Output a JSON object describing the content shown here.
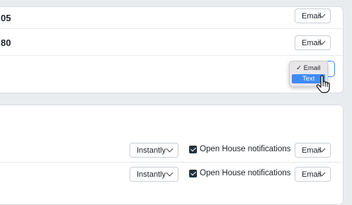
{
  "top_card": {
    "rows": [
      {
        "label": "05",
        "delivery": "Email"
      },
      {
        "label": "80",
        "delivery": "Email"
      }
    ],
    "dropdown": {
      "options": [
        {
          "label": "Email",
          "checked": true,
          "check_mark": "✓"
        },
        {
          "label": "Text",
          "checked": false,
          "highlighted": true
        }
      ]
    }
  },
  "bottom_card": {
    "rows": [
      {
        "frequency": "Instantly",
        "notification_label": "Open House notifications",
        "checked": true,
        "delivery": "Email"
      },
      {
        "frequency": "Instantly",
        "notification_label": "Open House notifications",
        "checked": true,
        "delivery": "Email"
      }
    ]
  },
  "icons": {
    "select_chevron": "chevron-down-icon",
    "checkbox": "checkbox-checked-icon",
    "cursor": "hand-pointer-cursor-icon"
  },
  "colors": {
    "accent_blue": "#3f8bf6",
    "checkbox_fill": "#25313d",
    "focus_border": "#3b8be8"
  }
}
